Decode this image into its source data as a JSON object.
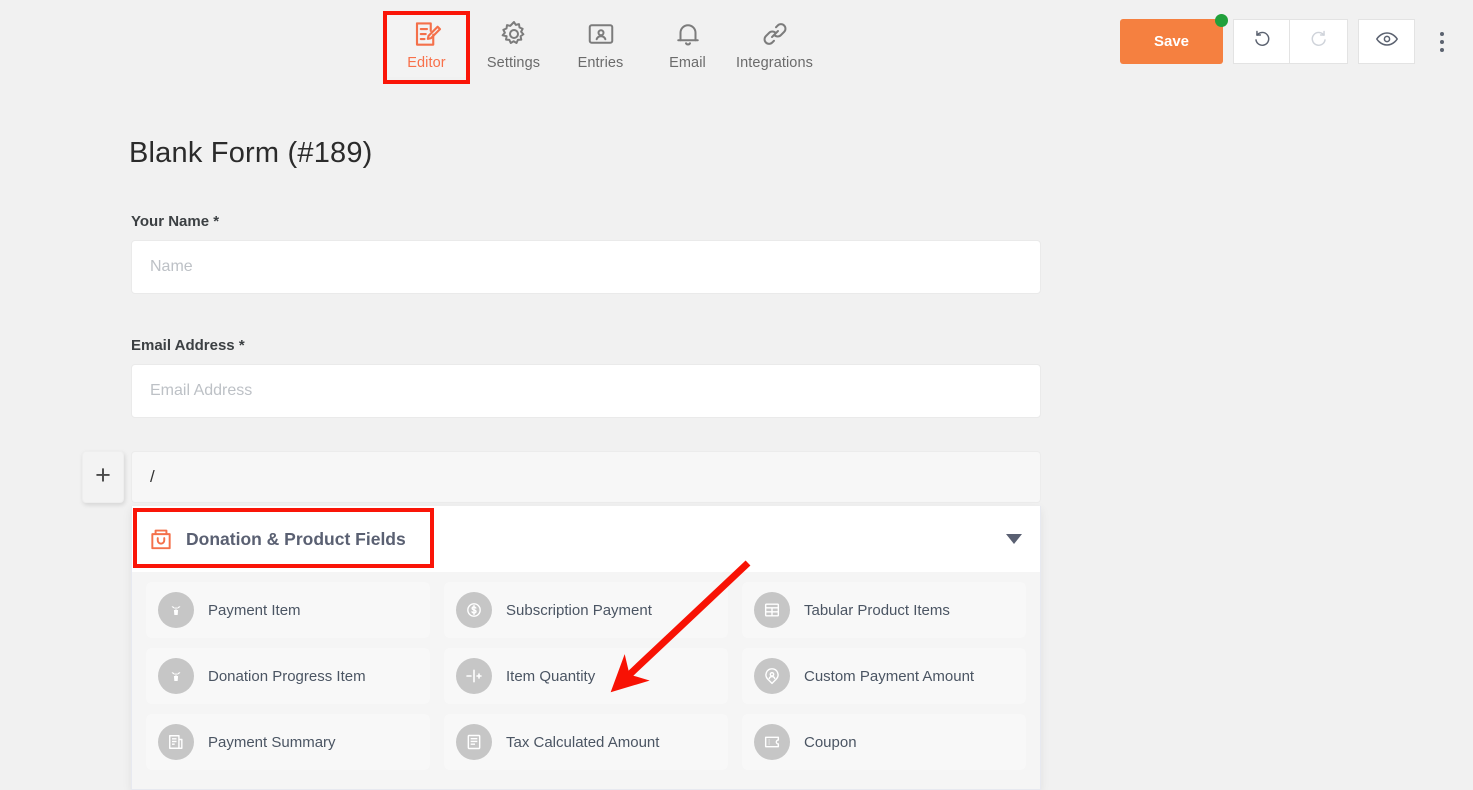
{
  "nav": {
    "items": [
      {
        "label": "Editor",
        "icon": "editor-icon",
        "active": true
      },
      {
        "label": "Settings",
        "icon": "gear-icon",
        "active": false
      },
      {
        "label": "Entries",
        "icon": "entries-icon",
        "active": false
      },
      {
        "label": "Email",
        "icon": "bell-icon",
        "active": false
      },
      {
        "label": "Integrations",
        "icon": "link-icon",
        "active": false
      }
    ]
  },
  "toolbar": {
    "save_label": "Save",
    "save_color": "#f58040",
    "unsaved_dot_color": "#21a03b",
    "undo_icon": "undo-icon",
    "redo_icon": "redo-icon",
    "preview_icon": "eye-icon",
    "more_icon": "kebab-menu-icon"
  },
  "form": {
    "title": "Blank Form (#189)",
    "fields": [
      {
        "label": "Your Name",
        "required": "*",
        "placeholder": "Name",
        "value": ""
      },
      {
        "label": "Email Address",
        "required": "*",
        "placeholder": "Email Address",
        "value": ""
      }
    ],
    "add_button_icon": "plus-icon",
    "slash_input_value": "/",
    "slash_input_placeholder": "/"
  },
  "panel": {
    "title": "Donation & Product Fields",
    "icon": "shopping-bag-icon",
    "icon_color": "#f4704a",
    "chevron_icon": "chevron-down-icon",
    "columns": [
      [
        {
          "label": "Payment Item",
          "icon": "plant-icon"
        },
        {
          "label": "Donation Progress Item",
          "icon": "plant-icon"
        },
        {
          "label": "Payment Summary",
          "icon": "document-list-icon"
        }
      ],
      [
        {
          "label": "Subscription Payment",
          "icon": "dollar-circle-icon"
        },
        {
          "label": "Item Quantity",
          "icon": "minus-plus-stepper-icon"
        },
        {
          "label": "Tax Calculated Amount",
          "icon": "receipt-icon"
        }
      ],
      [
        {
          "label": "Tabular Product Items",
          "icon": "table-icon"
        },
        {
          "label": "Custom Payment Amount",
          "icon": "user-pin-icon"
        },
        {
          "label": "Coupon",
          "icon": "ticket-icon"
        }
      ]
    ]
  },
  "annotations": {
    "highlight_color": "#fa1508",
    "boxes": [
      {
        "target": "Editor"
      },
      {
        "target": "Donation & Product Fields"
      }
    ],
    "arrow": {
      "points_to": "Item Quantity",
      "color": "#f81204"
    }
  }
}
